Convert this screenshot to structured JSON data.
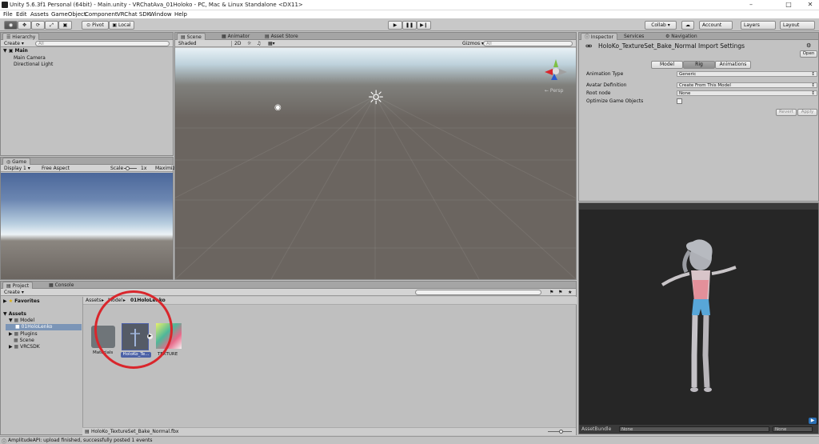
{
  "window": {
    "title": "Unity 5.6.3f1 Personal (64bit) - Main.unity - VRChatAva_01Holoko - PC, Mac & Linux Standalone <DX11>",
    "controls": [
      "–",
      "□",
      "✕"
    ]
  },
  "menu": [
    "File",
    "Edit",
    "Assets",
    "GameObject",
    "Component",
    "VRChat SDK",
    "Window",
    "Help"
  ],
  "toolbar": {
    "pivot": "Pivot",
    "local": "Local",
    "collab": "Collab ▾",
    "account": "Account",
    "layers": "Layers",
    "layout": "Layout"
  },
  "hierarchy": {
    "tab": "Hierarchy",
    "create": "Create ▾",
    "search_placeholder": "All",
    "scene_name": "Main",
    "items": [
      "Main Camera",
      "Directional Light"
    ]
  },
  "scene": {
    "tabs": [
      "Scene",
      "Animator",
      "Asset Store"
    ],
    "shading": "Shaded",
    "mode_2d": "2D",
    "gizmos": "Gizmos ▾",
    "search_placeholder": "All",
    "persp_label": "← Persp"
  },
  "game": {
    "tab": "Game",
    "display": "Display 1",
    "aspect": "Free Aspect",
    "scale_label": "Scale",
    "scale_value": "1x",
    "maximize": "Maximiz"
  },
  "project": {
    "tabs": [
      "Project",
      "Console"
    ],
    "create": "Create ▾",
    "favorites": "Favorites",
    "tree": {
      "assets": "Assets",
      "model": "Model",
      "holo": "01HoloLenko",
      "plugins": "Plugins",
      "scene": "Scene",
      "vrcsdk": "VRCSDK"
    },
    "breadcrumb": [
      "Assets",
      "Model",
      "01HoloLenko"
    ],
    "assets": [
      {
        "name": "Materials"
      },
      {
        "name": "HoloKo_Te..."
      },
      {
        "name": "TEXTURE"
      }
    ],
    "status_file": "HoloKo_TextureSet_Bake_Normal.fbx"
  },
  "inspector": {
    "tabs": [
      "Inspector",
      "Services",
      "Navigation"
    ],
    "title": "HoloKo_TextureSet_Bake_Normal Import Settings",
    "open": "Open",
    "mode_tabs": [
      "Model",
      "Rig",
      "Animations"
    ],
    "active_mode": "Rig",
    "animation_type_label": "Animation Type",
    "animation_type_value": "Generic",
    "avatar_def_label": "Avatar Definition",
    "avatar_def_value": "Create From This Model",
    "root_node_label": "Root node",
    "root_node_value": "None",
    "optimize_label": "Optimize Game Objects",
    "revert": "Revert",
    "apply": "Apply"
  },
  "preview": {
    "assetbundle_label": "AssetBundle",
    "bundle_value": "None",
    "variant_value": "None"
  },
  "status": {
    "message": "AmplitudeAPI: upload finished, successfully posted 1 events"
  },
  "colors": {
    "highlight_circle": "#d9262c",
    "selection": "#7b95b7"
  }
}
